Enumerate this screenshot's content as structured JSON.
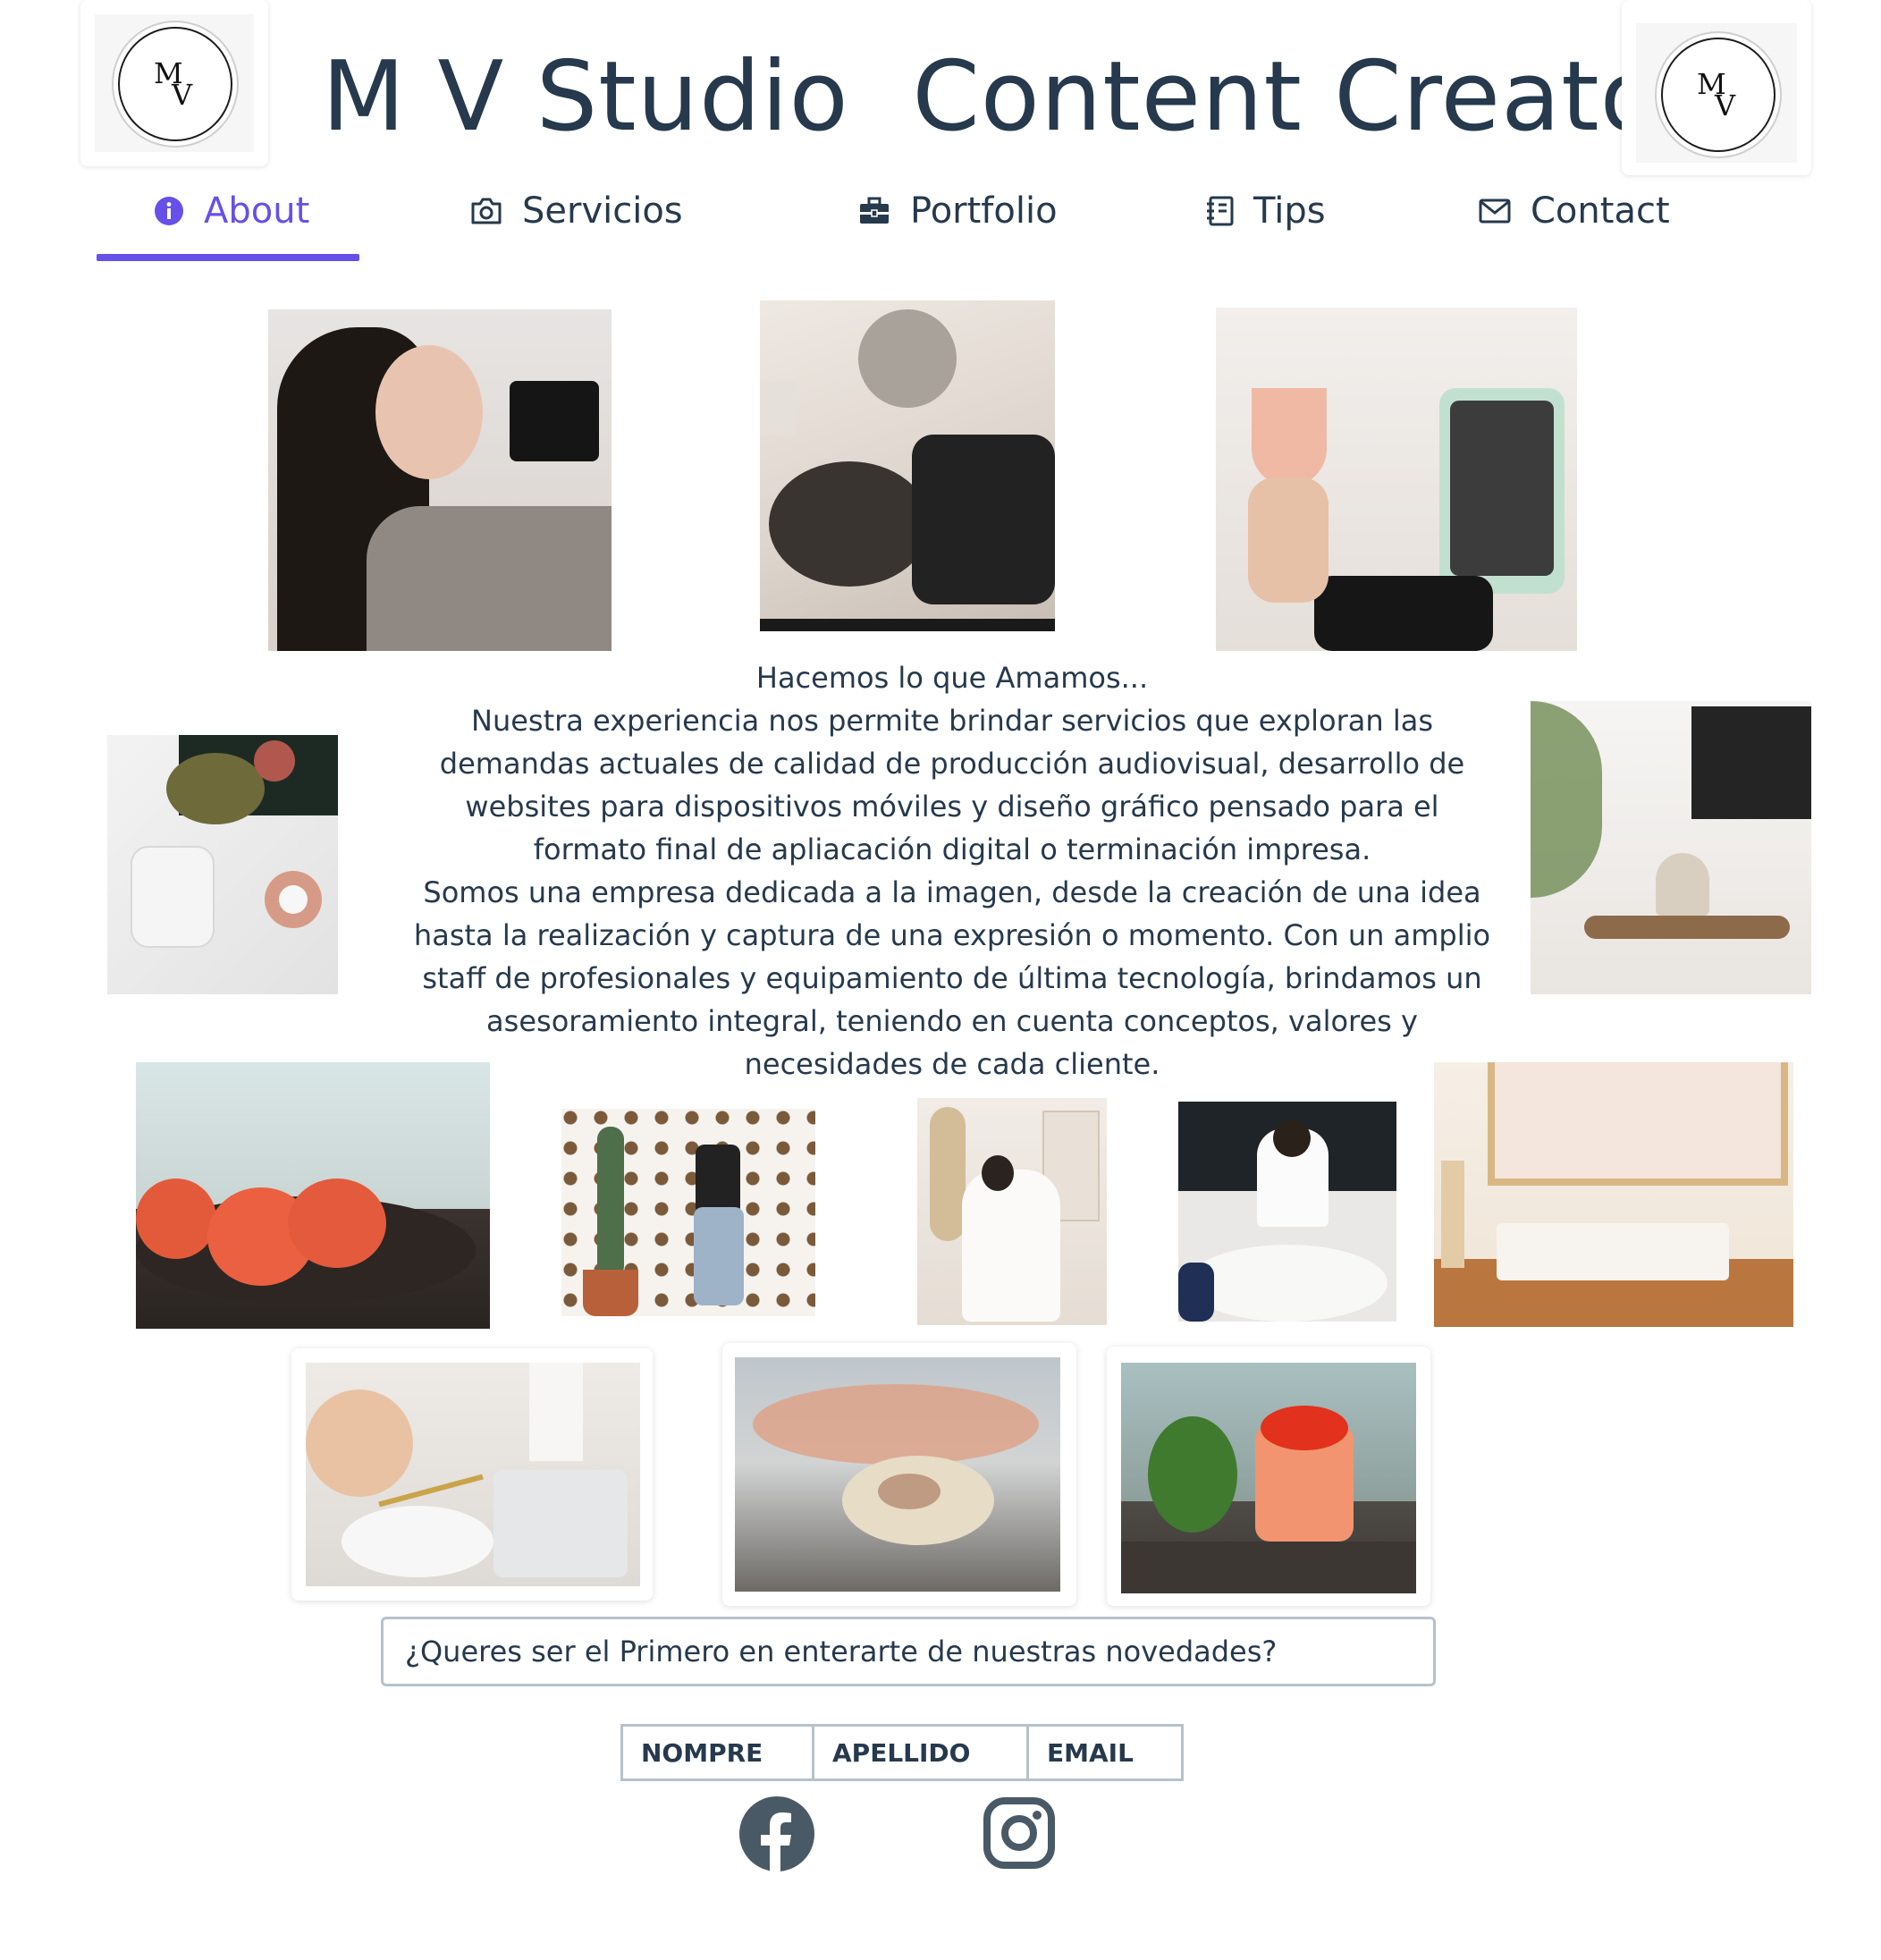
{
  "header": {
    "title": "M V Studio  Content Creator",
    "logo_left": {
      "letter_m": "M",
      "letter_v": "V"
    },
    "logo_right": {
      "letter_m": "M",
      "letter_v": "V"
    }
  },
  "nav": {
    "items": [
      {
        "label": "About",
        "icon": "info-icon",
        "active": true
      },
      {
        "label": "Servicios",
        "icon": "camera-icon",
        "active": false
      },
      {
        "label": "Portfolio",
        "icon": "briefcase-icon",
        "active": false
      },
      {
        "label": "Tips",
        "icon": "notebook-icon",
        "active": false
      },
      {
        "label": "Contact",
        "icon": "mail-icon",
        "active": false
      }
    ],
    "accent_color": "#6650e8"
  },
  "about": {
    "lines": [
      "Hacemos lo que Amamos...",
      "Nuestra experiencia nos permite brindar servicios que exploran las",
      "demandas actuales de calidad de producción audiovisual, desarrollo de",
      "websites para dispositivos móviles y diseño gráfico pensado para el",
      "formato final de apliacación digital o terminación impresa.",
      "Somos una empresa dedicada a la imagen, desde la creación de una idea",
      "hasta la realización y captura de una expresión o momento. Con un amplio",
      "staff de profesionales y equipamiento de última tecnología, brindamos un",
      "asesoramiento integral, teniendo en cuenta conceptos, valores y",
      "necesidades de cada cliente."
    ]
  },
  "newsletter": {
    "prompt": "¿Queres ser el Primero en enterarte de nuestras novedades?"
  },
  "form": {
    "fields": [
      "NOMPRE",
      "APELLIDO",
      "EMAIL"
    ]
  },
  "social": {
    "icons": [
      "facebook-icon",
      "instagram-icon"
    ],
    "color": "#4a5966"
  }
}
